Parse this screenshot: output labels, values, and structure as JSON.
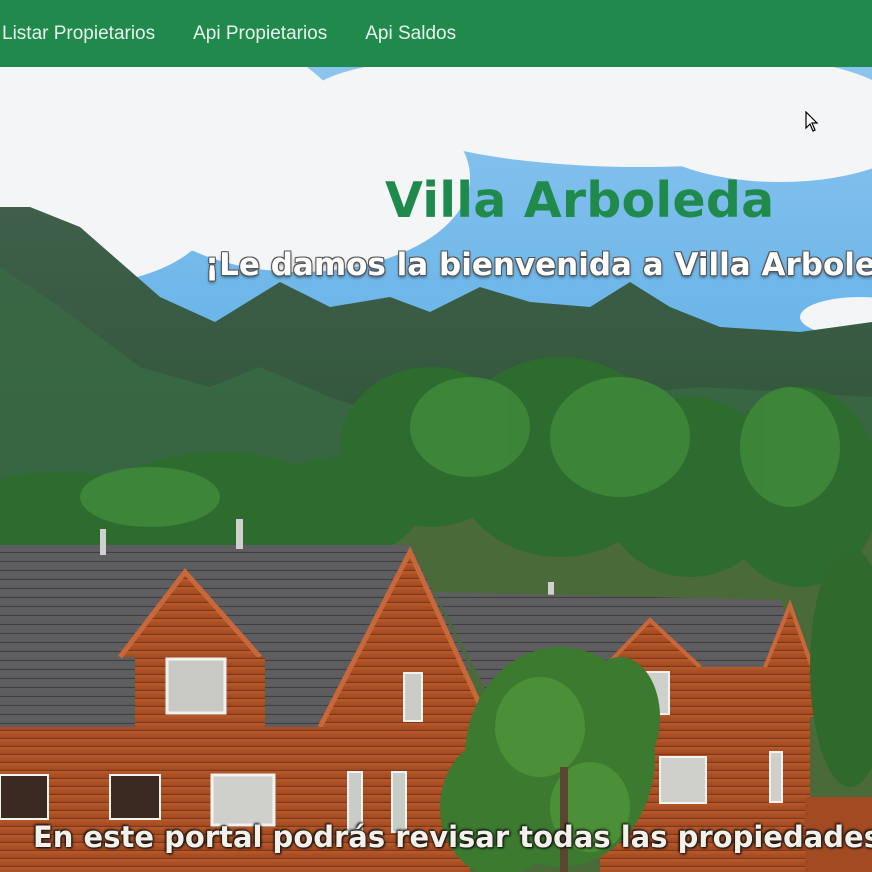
{
  "nav": {
    "items": [
      {
        "label": "Listar Propietarios"
      },
      {
        "label": "Api Propietarios"
      },
      {
        "label": "Api Saldos"
      }
    ],
    "background": "#1f8a4c"
  },
  "hero": {
    "title": "Villa Arboleda",
    "subtitle": "¡Le damos la bienvenida a Villa Arboleda",
    "footer_text": "En este portal podrás revisar todas las propiedades y s",
    "title_color": "#1f8a4c"
  },
  "icons": {
    "cursor": "mouse-pointer-icon"
  }
}
